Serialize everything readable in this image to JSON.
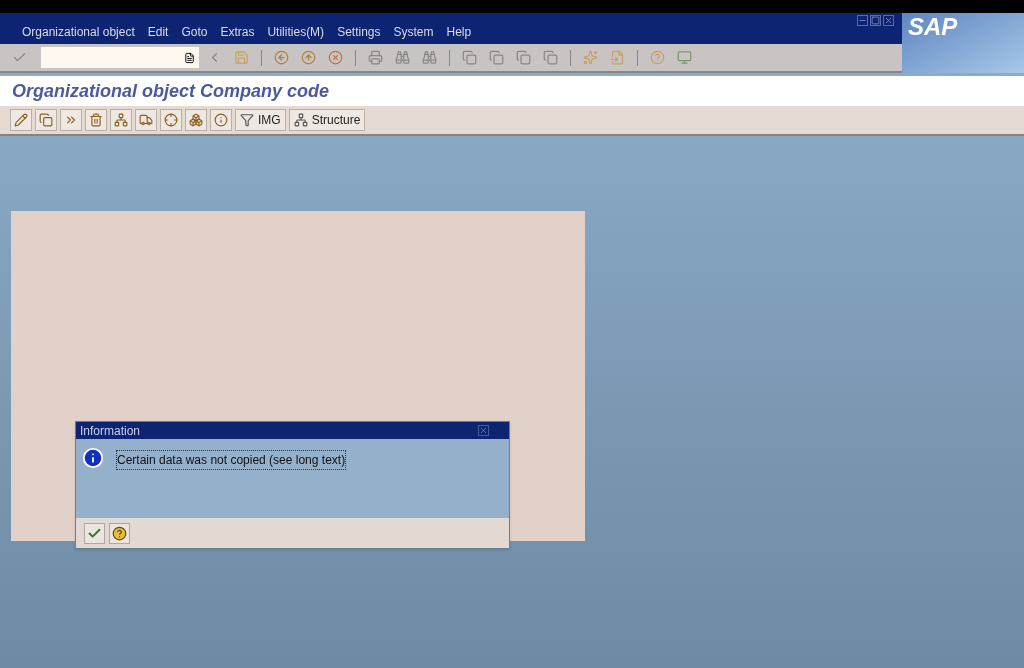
{
  "menu": [
    "Organizational object",
    "Edit",
    "Goto",
    "Extras",
    "Utilities(M)",
    "Settings",
    "System",
    "Help"
  ],
  "logo": "SAP",
  "title": "Organizational object Company code",
  "app_toolbar": [
    {
      "kind": "icon"
    },
    {
      "kind": "icon"
    },
    {
      "kind": "icon"
    },
    {
      "kind": "icon"
    },
    {
      "kind": "icon"
    },
    {
      "kind": "icon"
    },
    {
      "kind": "icon"
    },
    {
      "kind": "icon"
    },
    {
      "kind": "icon"
    },
    {
      "kind": "text",
      "label": "IMG"
    },
    {
      "kind": "text",
      "label": "Structure"
    }
  ],
  "dialog": {
    "title": "Information",
    "message": "Certain data was not copied (see long text)"
  }
}
